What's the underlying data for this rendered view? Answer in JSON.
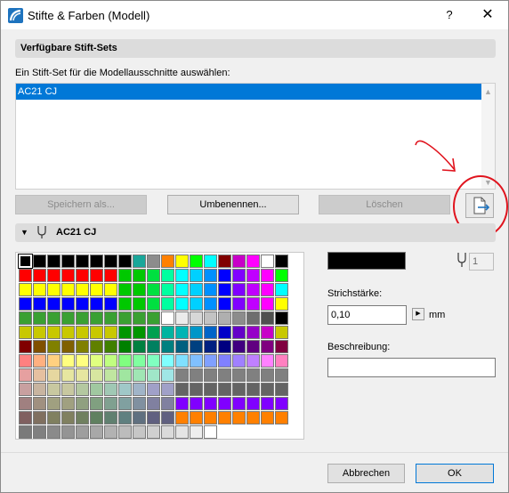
{
  "window": {
    "title": "Stifte & Farben (Modell)",
    "help_symbol": "?",
    "close_symbol": "✕"
  },
  "pensets": {
    "section_label": "Verfügbare Stift-Sets",
    "instruction": "Ein Stift-Set für die Modellausschnitte auswählen:",
    "items": [
      "AC21 CJ"
    ],
    "save_as_label": "Speichern als...",
    "rename_label": "Umbenennen...",
    "delete_label": "Löschen",
    "export_icon": "export-file-icon"
  },
  "pen_editor": {
    "set_name": "AC21 CJ",
    "selected_pen_index": "1",
    "selected_color": "#000000",
    "thickness_label": "Strichstärke:",
    "thickness_value": "0,10",
    "unit": "mm",
    "description_label": "Beschreibung:",
    "description_value": ""
  },
  "palette": {
    "rows": [
      [
        "#000000",
        "#000000",
        "#000000",
        "#000000",
        "#000000",
        "#000000",
        "#000000",
        "#000000",
        "#1aa79a",
        "#8c8c8c",
        "#ff8000",
        "#ffff00",
        "#00ff00",
        "#00ffff",
        "#800000",
        "#c800c8",
        "#ff00ff",
        "#ffffff",
        "#000000"
      ],
      [
        "#ff0000",
        "#ff0000",
        "#ff0000",
        "#ff0000",
        "#ff0000",
        "#ff0000",
        "#ff0000",
        "#00c800",
        "#00c800",
        "#00e040",
        "#00ffa0",
        "#00ffff",
        "#00d0ff",
        "#0090ff",
        "#0000ff",
        "#8000ff",
        "#c000ff",
        "#ff00ff",
        "#00ff00"
      ],
      [
        "#ffff00",
        "#ffff00",
        "#ffff00",
        "#ffff00",
        "#ffff00",
        "#ffff00",
        "#ffff00",
        "#00c800",
        "#00c800",
        "#00e040",
        "#00ffa0",
        "#00ffff",
        "#00d0ff",
        "#0090ff",
        "#0000ff",
        "#8000ff",
        "#c000ff",
        "#ff00ff",
        "#00ffff"
      ],
      [
        "#0000ff",
        "#0000ff",
        "#0000ff",
        "#0000ff",
        "#0000ff",
        "#0000ff",
        "#0000ff",
        "#00c800",
        "#00c800",
        "#00e040",
        "#00ffa0",
        "#00ffff",
        "#00d0ff",
        "#0090ff",
        "#0000ff",
        "#8000ff",
        "#c000ff",
        "#ff00ff",
        "#ffff00"
      ],
      [
        "#3aa032",
        "#3aa032",
        "#3aa032",
        "#3aa032",
        "#3aa032",
        "#3aa032",
        "#3aa032",
        "#3aa032",
        "#3aa032",
        "#3aa032",
        "#ffffff",
        "#ebebeb",
        "#d7d7d7",
        "#c3c3c3",
        "#afafaf",
        "#8c8c8c",
        "#6e6e6e",
        "#505050",
        "#000000"
      ],
      [
        "#c8c800",
        "#c8c800",
        "#c8c800",
        "#c8c800",
        "#c8c800",
        "#c8c800",
        "#c8c800",
        "#009600",
        "#009600",
        "#00a050",
        "#00b4a0",
        "#00b4b4",
        "#0096c8",
        "#0064c8",
        "#0000c8",
        "#6400c8",
        "#9600c8",
        "#c800c8",
        "#c8c800"
      ],
      [
        "#800000",
        "#805000",
        "#808000",
        "#806000",
        "#808000",
        "#608000",
        "#408000",
        "#008000",
        "#008040",
        "#008060",
        "#008080",
        "#006080",
        "#004080",
        "#002080",
        "#000080",
        "#400080",
        "#600080",
        "#800080",
        "#800040"
      ],
      [
        "#ff8080",
        "#ffb080",
        "#ffd080",
        "#ffff80",
        "#ffff80",
        "#e0ff80",
        "#c0ff80",
        "#80ff80",
        "#80ffa0",
        "#80ffc0",
        "#80ffff",
        "#80e0ff",
        "#80c0ff",
        "#80a0ff",
        "#8080ff",
        "#a080ff",
        "#c080ff",
        "#ff80ff",
        "#ff80c0"
      ],
      [
        "#e6a0a0",
        "#e6c0a0",
        "#e6d7a0",
        "#e6e6a0",
        "#e6e6a0",
        "#d7e6a0",
        "#c0e6a0",
        "#a0e6a0",
        "#a0e6b4",
        "#a0e6c8",
        "#a0e6e6",
        "#808080",
        "#808080",
        "#808080",
        "#808080",
        "#808080",
        "#808080",
        "#808080",
        "#808080"
      ],
      [
        "#c8a0a0",
        "#c8b4a0",
        "#c8c8a0",
        "#c8c8a0",
        "#b4c8a0",
        "#a0c8a0",
        "#a0c8b4",
        "#a0c8c8",
        "#a0b4c8",
        "#a0a0c8",
        "#a0a0c8",
        "#646464",
        "#646464",
        "#646464",
        "#646464",
        "#646464",
        "#646464",
        "#646464",
        "#646464"
      ],
      [
        "#a08080",
        "#a09080",
        "#a0a080",
        "#a0a080",
        "#90a080",
        "#80a080",
        "#80a090",
        "#80a0a0",
        "#8090a0",
        "#8080a0",
        "#8080a0",
        "#8000ff",
        "#8000ff",
        "#8000ff",
        "#8000ff",
        "#8000ff",
        "#8000ff",
        "#8000ff",
        "#8000ff"
      ],
      [
        "#806060",
        "#807060",
        "#808060",
        "#808060",
        "#708060",
        "#608060",
        "#608070",
        "#608080",
        "#607080",
        "#606080",
        "#606080",
        "#ff8000",
        "#ff8000",
        "#ff8000",
        "#ff8000",
        "#ff8000",
        "#ff8000",
        "#ff8000",
        "#ff8000"
      ],
      [
        "#7a7a7a",
        "#808080",
        "#8a8a8a",
        "#949494",
        "#9e9e9e",
        "#a8a8a8",
        "#b2b2b2",
        "#bcbcbc",
        "#c6c6c6",
        "#d0d0d0",
        "#dadada",
        "#e4e4e4",
        "#eeeeee",
        "#ffffff",
        "",
        "",
        "",
        "",
        ""
      ]
    ]
  },
  "footer": {
    "cancel_label": "Abbrechen",
    "ok_label": "OK"
  }
}
